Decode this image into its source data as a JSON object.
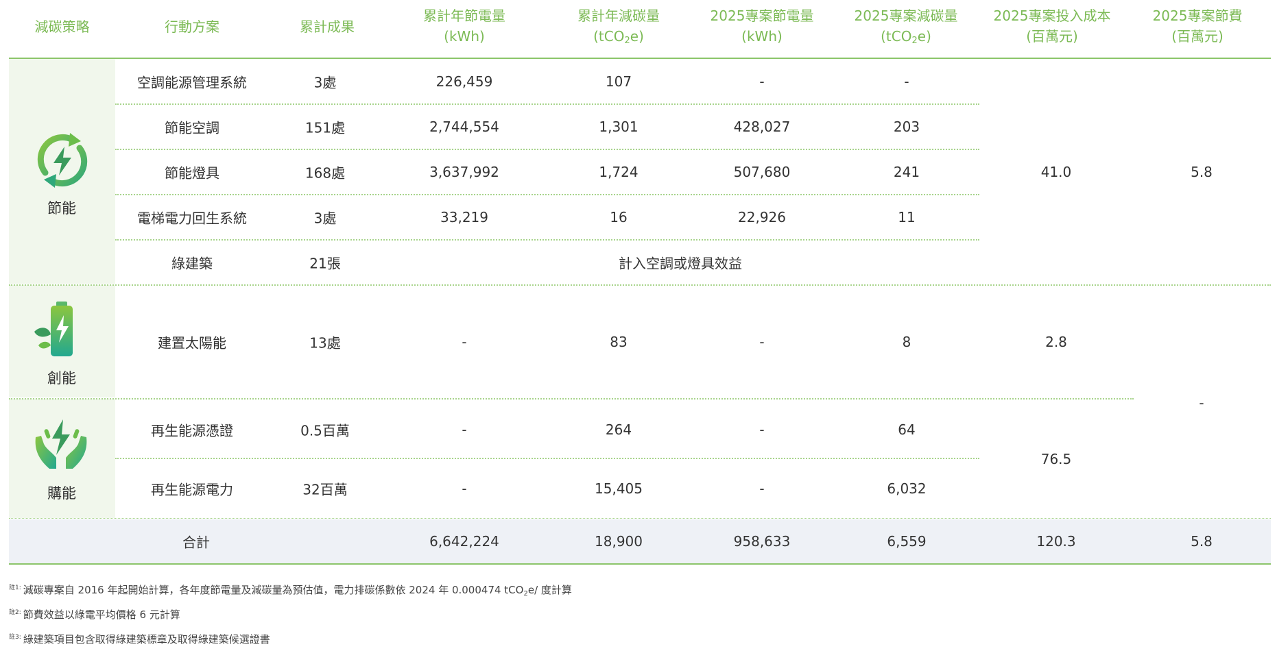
{
  "headers": {
    "strategy": "減碳策略",
    "action": "行動方案",
    "cumulative": "累計成果",
    "cum_saving_line1": "累計年節電量",
    "cum_saving_line2": "(kWh)",
    "cum_reduction_line1": "累計年減碳量",
    "cum_reduction_line2a": "(tCO",
    "cum_reduction_line2b": "2",
    "cum_reduction_line2c": "e)",
    "proj_saving_line1": "2025專案節電量",
    "proj_saving_line2": "(kWh)",
    "proj_reduction_line1": "2025專案減碳量",
    "proj_reduction_line2a": "(tCO",
    "proj_reduction_line2b": "2",
    "proj_reduction_line2c": "e)",
    "proj_cost_line1": "2025專案投入成本",
    "proj_cost_line2": "(百萬元)",
    "proj_fee_line1": "2025專案節費",
    "proj_fee_line2": "(百萬元)"
  },
  "categories": {
    "save": "節能",
    "create": "創能",
    "buy": "購能"
  },
  "rows": [
    {
      "action": "空調能源管理系統",
      "result": "3處",
      "cum_kwh": "226,459",
      "cum_t": "107",
      "proj_kwh": "-",
      "proj_t": "-"
    },
    {
      "action": "節能空調",
      "result": "151處",
      "cum_kwh": "2,744,554",
      "cum_t": "1,301",
      "proj_kwh": "428,027",
      "proj_t": "203"
    },
    {
      "action": "節能燈具",
      "result": "168處",
      "cum_kwh": "3,637,992",
      "cum_t": "1,724",
      "proj_kwh": "507,680",
      "proj_t": "241"
    },
    {
      "action": "電梯電力回生系統",
      "result": "3處",
      "cum_kwh": "33,219",
      "cum_t": "16",
      "proj_kwh": "22,926",
      "proj_t": "11"
    },
    {
      "action": "綠建築",
      "result": "21張",
      "merged_note": "計入空調或燈具效益"
    },
    {
      "action": "建置太陽能",
      "result": "13處",
      "cum_kwh": "-",
      "cum_t": "83",
      "proj_kwh": "-",
      "proj_t": "8"
    },
    {
      "action": "再生能源憑證",
      "result": "0.5百萬",
      "cum_kwh": "-",
      "cum_t": "264",
      "proj_kwh": "-",
      "proj_t": "64"
    },
    {
      "action": "再生能源電力",
      "result": "32百萬",
      "cum_kwh": "-",
      "cum_t": "15,405",
      "proj_kwh": "-",
      "proj_t": "6,032"
    }
  ],
  "merged": {
    "save_cost": "41.0",
    "save_fee": "5.8",
    "create_cost": "2.8",
    "buy_cost": "76.5",
    "create_buy_fee": "-"
  },
  "total": {
    "label": "合計",
    "cum_kwh": "6,642,224",
    "cum_t": "18,900",
    "proj_kwh": "958,633",
    "proj_t": "6,559",
    "cost": "120.3",
    "fee": "5.8"
  },
  "notes": [
    {
      "mark": "註1:",
      "text_a": "減碳專案自 2016 年起開始計算，各年度節電量及減碳量為預估值，電力排碳係數依 2024 年 0.000474 tCO",
      "text_sub": "2",
      "text_b": "e/ 度計算"
    },
    {
      "mark": "註2:",
      "text": "節費效益以綠電平均價格 6 元計算"
    },
    {
      "mark": "註3:",
      "text": "綠建築項目包含取得綠建築標章及取得綠建築候選證書"
    }
  ],
  "colors": {
    "header_text": "#7cba55",
    "rule": "#8cc56a",
    "dotted_rule": "#a8d48c",
    "category_band": "#f1f7ec",
    "total_band": "#eef1f6",
    "icon_green_dark": "#3a9b5c",
    "icon_green_light": "#8cc63f",
    "icon_teal": "#22a88f"
  },
  "icons": {
    "save": "energy-saving-cycle-icon",
    "create": "battery-leaf-icon",
    "buy": "hands-energy-icon"
  }
}
